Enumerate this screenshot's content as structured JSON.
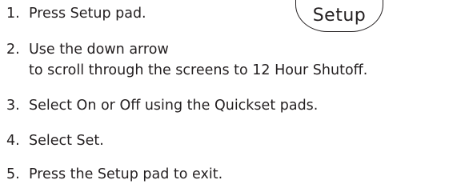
{
  "setup_pad": {
    "label": "Setup"
  },
  "steps": [
    {
      "number": "1.",
      "text": "Press Setup pad."
    },
    {
      "number": "2.",
      "text": "Use the down arrow",
      "continuation": "to scroll through the screens to 12 Hour Shutoff."
    },
    {
      "number": "3.",
      "text": "Select On or Off using the Quickset pads."
    },
    {
      "number": "4.",
      "text": "Select Set."
    },
    {
      "number": "5.",
      "text": "Press the Setup pad to exit."
    }
  ]
}
